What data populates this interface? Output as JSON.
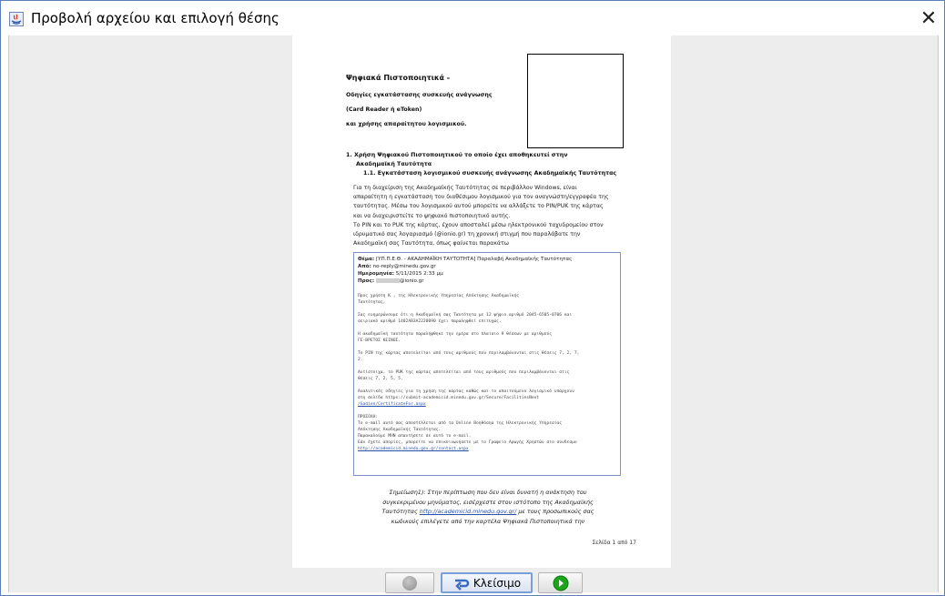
{
  "window": {
    "title": "Προβολή αρχείου και επιλογή θέσης",
    "close_glyph": "✕"
  },
  "document": {
    "header": [
      "Ψηφιακά Πιστοποιητικά -",
      "Οδηγίες εγκατάστασης συσκευής ανάγνωσης",
      "(Card Reader ή eToken)",
      "και χρήσης απαραίτητου λογισμικού."
    ],
    "section1_title_line1": "1.  Χρήση Ψηφιακού Πιστοποιητικού το οποίο έχει αποθηκευτεί στην",
    "section1_title_line2": "Ακαδημαϊκή Ταυτότητα",
    "section11_title": "1.1. Εγκατάσταση λογισμικού συσκευής ανάγνωσης Ακαδημαϊκής Ταυτότητας",
    "body_lines": [
      "Για τη διαχείριση της Ακαδημαϊκής Ταυτότητας σε περιβάλλον Windows, είναι",
      "απαραίτητη η εγκατάσταση του διαθέσιμου λογισμικού για τον αναγνώστη/εγγραφέα της",
      "ταυτότητας. Μέσω του λογισμικού αυτού μπορείτε να αλλάξετε το PIN/PUK της κάρτας",
      "και να διαχειριστείτε το ψηφιακό πιστοποιητικό αυτής.",
      "Το PIN και το PUK της κάρτας, έχουν αποσταλεί μέσω ηλεκτρονικού ταχυδρομείου στον",
      "ιδρυματικό σας λογαριασμό (@ionio.gr) τη χρονική στιγμή που παραλάβατε την",
      "Ακαδημαϊκή σας Ταυτότητα, όπως φαίνεται παρακάτω"
    ],
    "email": {
      "subject_label": "Θέμα:",
      "subject": "[ΥΠ.Π.Ε.Θ. - ΑΚΑΔΗΜΑΪΚΗ ΤΑΥΤΟΤΗΤΑ] Παραλαβή Ακαδημαϊκής Ταυτότητας",
      "from_label": "Από:",
      "from": "no-reply@minedu.gov.gr",
      "date_label": "Ημερομηνία:",
      "date": "5/11/2015 2:33 μμ",
      "to_label": "Προς:",
      "to": "@ionio.gr",
      "lines": [
        "Προς χρήστη Κ                , της Ηλεκτρονικής Υπηρεσίας Απόκτησης Ακαδημαϊκής",
        "Ταυτότητας,",
        "",
        "Σας ενημερώνουμε ότι η Ακαδημαϊκή σας Ταυτότητα με 12 ψήφιο αριθμό 2045-6505-0706 και",
        "σειριακό αριθμό 1402ΑΒ3Α2220090 έχει παραληφθεί επιτυχώς.",
        "",
        "Η ακαδημαϊκή ταυτότητα παραλήφθηκε την ημέρα στο πλαίσιο 9 θέσεων με αριθμούς",
        "ΓΕ-ΒΡΕΤΟΣ ΚΕΙΝΟΣ.",
        "",
        "Το PIN της κάρτας αποτελείται από τους αριθμούς που περιλαμβάνονται στις θέσεις 7, 2, 7,",
        "2.",
        "",
        "Αντίστοιχα, το PUK της κάρτας αποτελείται από τους αριθμούς που περιλαμβάνονται στις",
        "θέσεις 7, 2, 5, 5.",
        "",
        "Αναλυτικές οδηγίες για τη χρήση της κάρτας καθώς και το απαιτούμενο λογισμικό υπάρχουν",
        "στη σελίδα https://submit-academicid.minedu.gov.gr/Secure/FacilitiesNext",
        "/Gadien/CertificateFor.aspx",
        "",
        "ΠΡΟΣΟΧΗ:",
        "Το e-mail αυτό σας αποστέλλεται από τα Online Βοηθόσηα της Ηλεκτρονικής Υπηρεσίας",
        "Απόκτησης Ακαδημαϊκής Ταυτότητας.",
        "Παρακαλούμε ΜΗΝ απαντήσετε σε αυτό το e-mail.",
        "Εάν έχετε απορίες, μπορείτε να επικοινωνήσετε με το Γραφείο Αρωγής Χρηστών στο σύνδεσμο",
        "http://academicid.minedu.gov.gr/contact.aspx"
      ]
    },
    "note_lines": [
      "Σημείωση1): Στην περίπτωση που δεν είναι δυνατή η ανάκτηση του",
      "συγκεκριμένου μηνύματος, εισέρχεστε στον ιστότοπο της Ακαδημαϊκής",
      "Ταυτότητας http://academicid.minedu.gov.gr/ με τους προσωπικούς σας",
      "κωδικούς επιλέγετε από την καρτέλα Ψηφιακά Πιστοποιητικά την"
    ],
    "page_number": "Σελίδα 1 από 17"
  },
  "buttons": {
    "close_label": "Κλείσιμο"
  },
  "colors": {
    "next_green": "#1aa51a",
    "prev_grey": "#9a9a9a",
    "email_border": "#7e93c4",
    "close_border": "#7a9ed6"
  },
  "icons": {
    "app": "java-app-icon",
    "close": "close-icon",
    "prev": "previous-icon",
    "close_button": "close-arrow-icon",
    "next": "next-icon"
  }
}
